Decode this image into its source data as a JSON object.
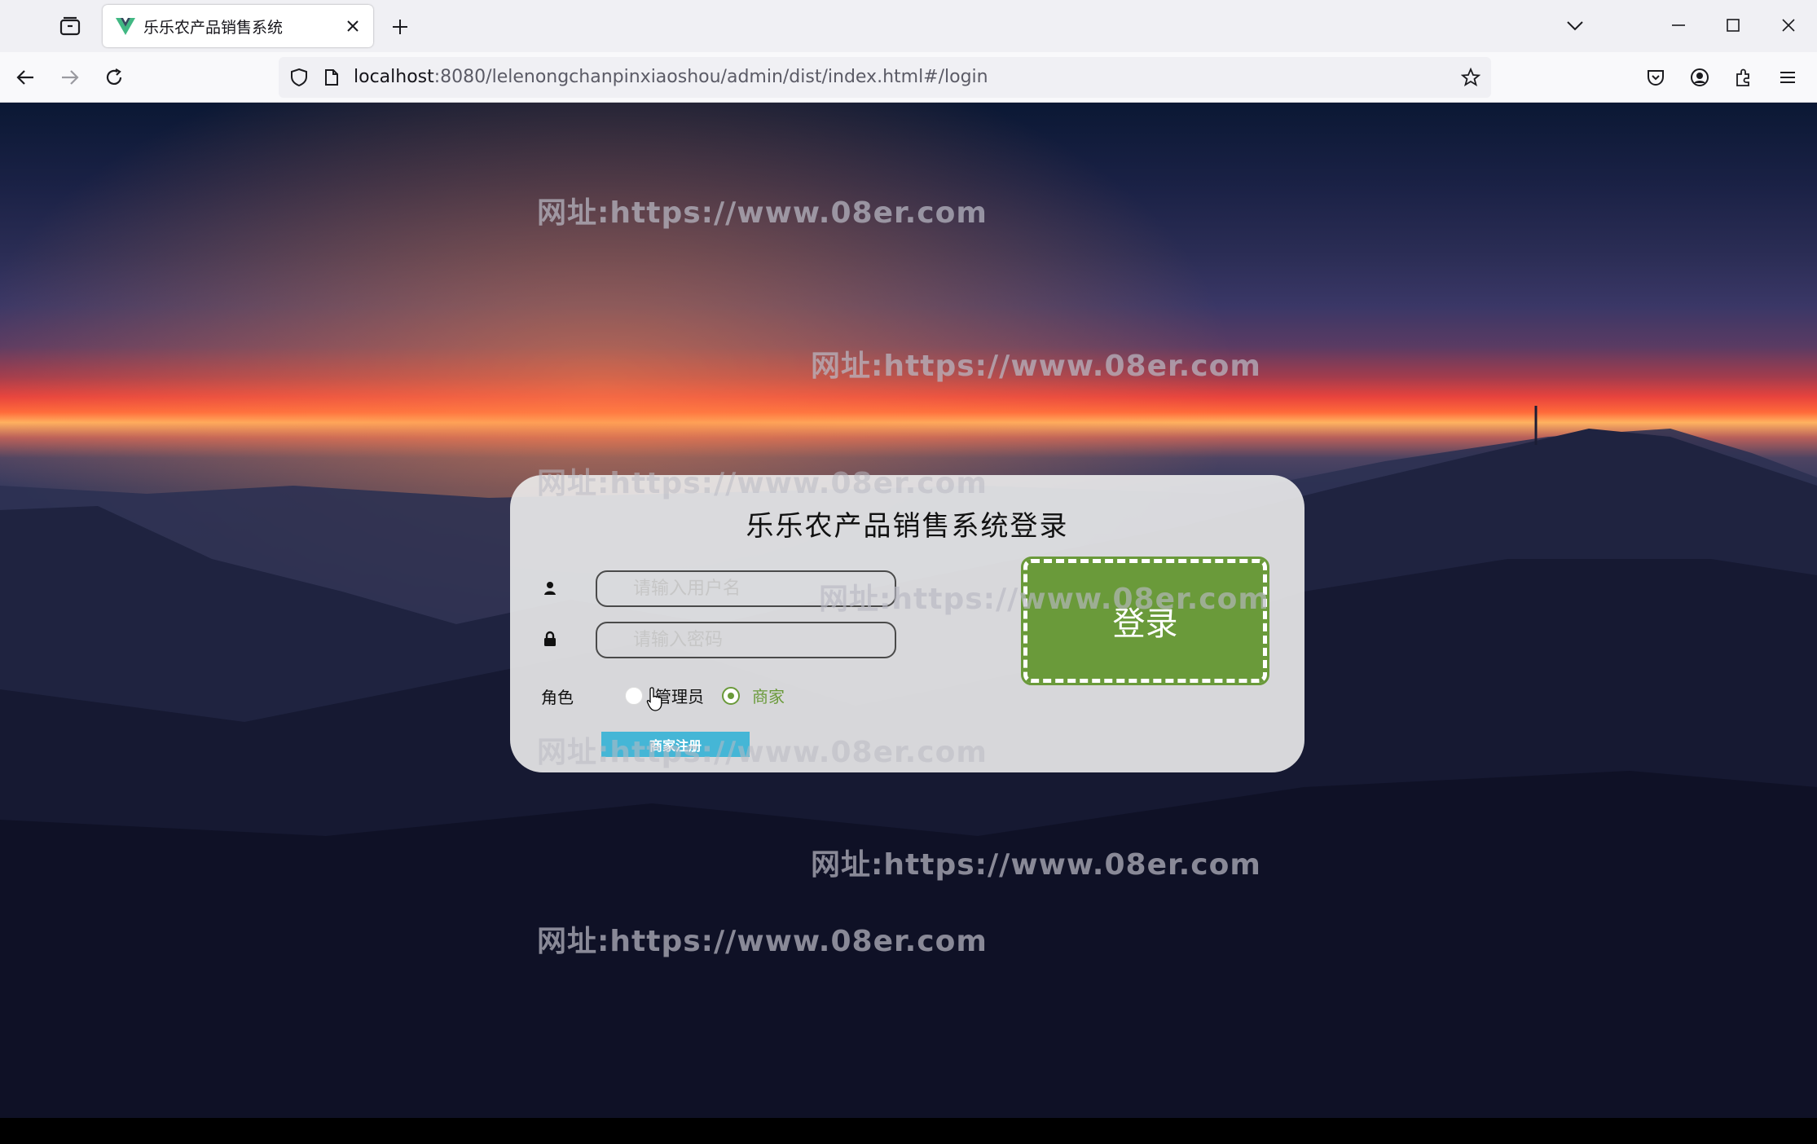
{
  "browser": {
    "tab_title": "乐乐农产品销售系统",
    "url_host": "localhost",
    "url_rest": ":8080/lelenongchanpinxiaoshou/admin/dist/index.html#/login"
  },
  "watermark_text": "网址:https://www.08er.com",
  "login": {
    "title": "乐乐农产品销售系统登录",
    "username_placeholder": "请输入用户名",
    "password_placeholder": "请输入密码",
    "role_label": "角色",
    "roles": [
      {
        "label": "管理员",
        "selected": false
      },
      {
        "label": "商家",
        "selected": true
      }
    ],
    "register_label": "商家注册",
    "login_label": "登录",
    "accent_color": "#6a9a3a",
    "register_color": "#45b6d6"
  }
}
